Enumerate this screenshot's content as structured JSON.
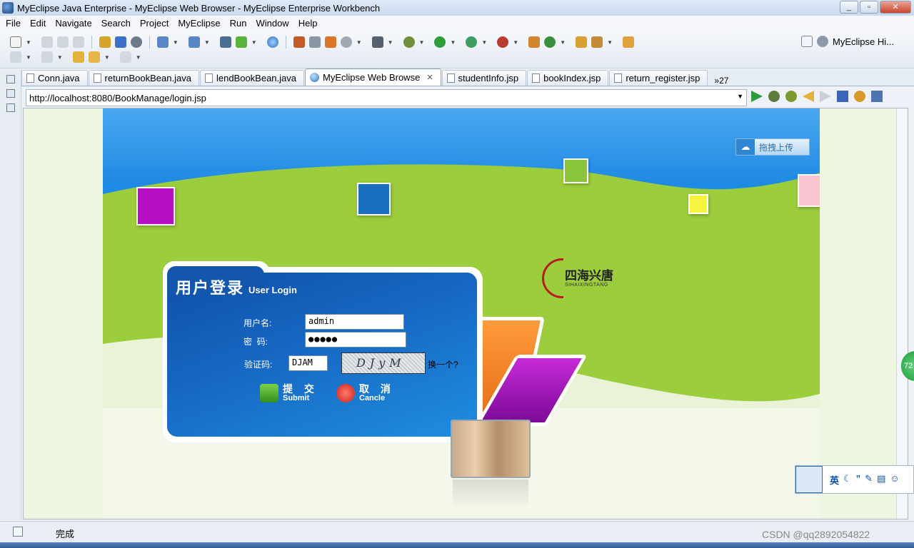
{
  "window": {
    "title": "MyEclipse Java Enterprise - MyEclipse Web Browser - MyEclipse Enterprise Workbench",
    "minimize": "_",
    "maximize": "▫",
    "close": "✕"
  },
  "menu": {
    "items": [
      "File",
      "Edit",
      "Navigate",
      "Search",
      "Project",
      "MyEclipse",
      "Run",
      "Window",
      "Help"
    ]
  },
  "toolbar": {
    "perspective_label": "MyEclipse Hi..."
  },
  "tabs": [
    {
      "label": "Conn.java",
      "icon": "java-file-icon"
    },
    {
      "label": "returnBookBean.java",
      "icon": "java-file-icon"
    },
    {
      "label": "lendBookBean.java",
      "icon": "java-file-icon"
    },
    {
      "label": "MyEclipse Web Browse",
      "icon": "globe-icon",
      "active": true
    },
    {
      "label": "studentInfo.jsp",
      "icon": "jsp-file-icon"
    },
    {
      "label": "bookIndex.jsp",
      "icon": "jsp-file-icon"
    },
    {
      "label": "return_register.jsp",
      "icon": "jsp-file-icon"
    }
  ],
  "tab_overflow": "»27",
  "address": {
    "url": "http://localhost:8080/BookManage/login.jsp"
  },
  "page": {
    "upload_button": "拖拽上传",
    "brand_name": "四海兴唐",
    "brand_sub": "SIHAIXINGTANG",
    "login_title_zh": "用户登录",
    "login_title_en": "User Login",
    "username_label": "用户名:",
    "username_value": "admin",
    "password_label": "密  码:",
    "password_value": "●●●●●",
    "captcha_label": "验证码:",
    "captcha_value": "DJAM",
    "captcha_image_text": "DJyM",
    "captcha_refresh": "换一个?",
    "submit_zh": "提 交",
    "submit_en": "Submit",
    "cancel_zh": "取 消",
    "cancel_en": "Cancle"
  },
  "qq_widget": {
    "ime_label": "英"
  },
  "side_badge": "72",
  "status": {
    "text": "完成"
  },
  "watermark": "CSDN @qq2892054822",
  "colors": {
    "sky_blue": "#1f8ae3",
    "hill_green": "#9ccd3c",
    "card_blue": "#1668c3"
  }
}
